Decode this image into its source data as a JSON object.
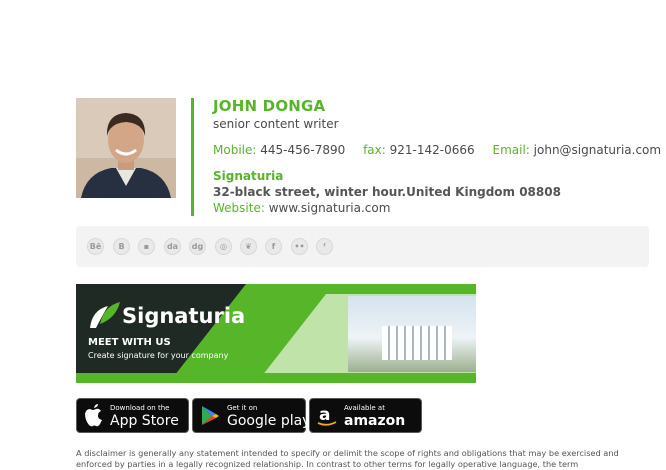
{
  "profile": {
    "name": "JOHN DONGA",
    "title": "senior content writer"
  },
  "contact": {
    "mobile_label": "Mobile:",
    "mobile": "445-456-7890",
    "fax_label": "fax:",
    "fax": "921-142-0666",
    "email_label": "Email:",
    "email": "john@signaturia.com"
  },
  "company": {
    "name": "Signaturia",
    "address": "32-black street, winter hour.United Kingdom 08808",
    "website_label": "Website:",
    "website": "www.signaturia.com"
  },
  "social_icons": [
    {
      "name": "behance-icon",
      "glyph": "Bē"
    },
    {
      "name": "blogger-icon",
      "glyph": "B"
    },
    {
      "name": "delicious-icon",
      "glyph": "▪"
    },
    {
      "name": "deviantart-icon",
      "glyph": "da"
    },
    {
      "name": "digg-icon",
      "glyph": "dg"
    },
    {
      "name": "dribbble-icon",
      "glyph": "◎"
    },
    {
      "name": "evernote-icon",
      "glyph": "❦"
    },
    {
      "name": "facebook-icon",
      "glyph": "f"
    },
    {
      "name": "flickr-icon",
      "glyph": "••"
    },
    {
      "name": "foursquare-icon",
      "glyph": "ᶠ"
    }
  ],
  "banner": {
    "brand": "Signaturia",
    "headline": "MEET WITH US",
    "tagline": "Create signature for your company"
  },
  "stores": {
    "apple_small": "Download on the",
    "apple_big": "App Store",
    "google_small": "Get it on",
    "google_big": "Google play",
    "amazon_small": "Available at",
    "amazon_big": "amazon"
  },
  "disclaimer": "A disclaimer is generally any statement intended to specify or delimit the scope of rights and obligations that may be exercised and enforced by parties in a legally recognized relationship. In contrast to other terms for legally operative language, the term",
  "colors": {
    "accent": "#57b52a",
    "text": "#4a4a4a"
  }
}
